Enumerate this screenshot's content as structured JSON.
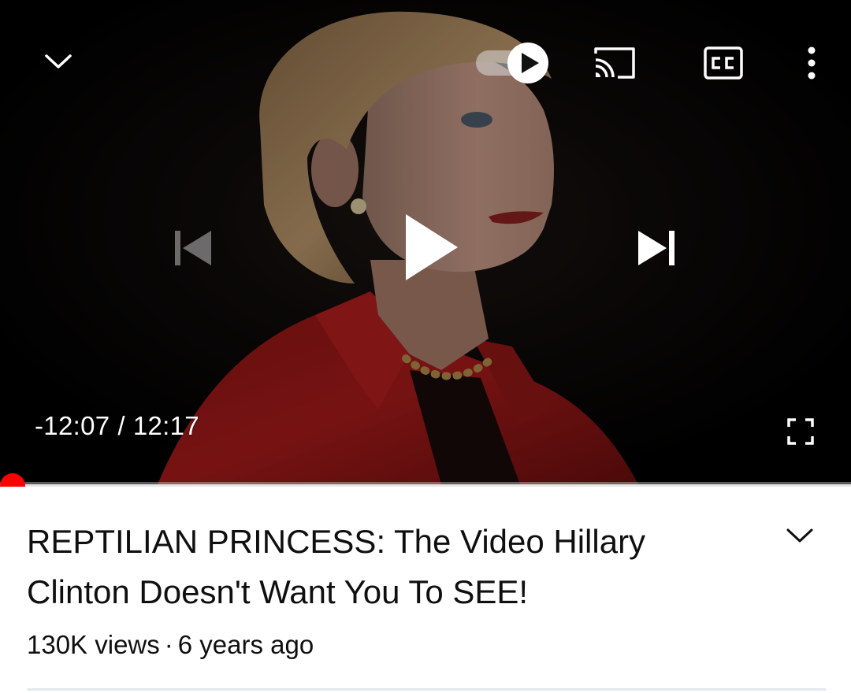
{
  "player": {
    "time_remaining": "-12:07",
    "time_separator": "/",
    "duration": "12:17",
    "progress_fraction": 0.0,
    "autoplay_on": true,
    "icons": {
      "collapse": "chevron-down-icon",
      "autoplay": "autoplay-toggle-icon",
      "cast": "cast-icon",
      "captions": "closed-captions-icon",
      "more": "more-vert-icon",
      "previous": "skip-previous-icon",
      "play": "play-icon",
      "next": "skip-next-icon",
      "fullscreen": "fullscreen-icon"
    },
    "colors": {
      "progress": "#ff0000",
      "jacket": "#9e1616"
    }
  },
  "video": {
    "title": "REPTILIAN PRINCESS: The Video Hillary Clinton Doesn't Want You To SEE!",
    "views": "130K views",
    "meta_separator": "·",
    "age": "6 years ago"
  }
}
